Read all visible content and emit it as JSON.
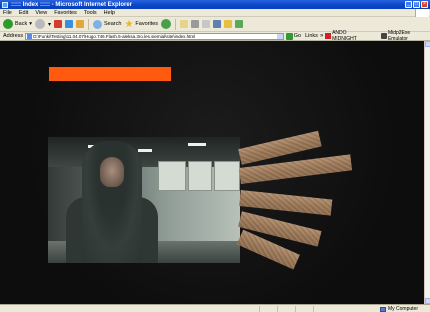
{
  "window": {
    "title": "::::: Index ::::: - Microsoft Internet Explorer"
  },
  "menu": {
    "items": [
      "File",
      "Edit",
      "View",
      "Favorites",
      "Tools",
      "Help"
    ]
  },
  "toolbar": {
    "back_label": "Back",
    "search_label": "Search",
    "favorites_label": "Favorites"
  },
  "address": {
    "label": "Address",
    "value": "D:\\Funki\\Testing\\11.04.07\\Hugo.746.Flash.5-aleksa.3ro.les.siemial\\site\\index.html",
    "go_label": "Go",
    "links_label": "Links",
    "ext_label": "ANDO MIDNIGHT",
    "emulator_label": "Midp2Exe Emulator"
  },
  "statusbar": {
    "zone_label": "My Computer"
  },
  "colors": {
    "accent_orange": "#ff5a10",
    "background": "#111111",
    "plank": "#a07c5c"
  }
}
